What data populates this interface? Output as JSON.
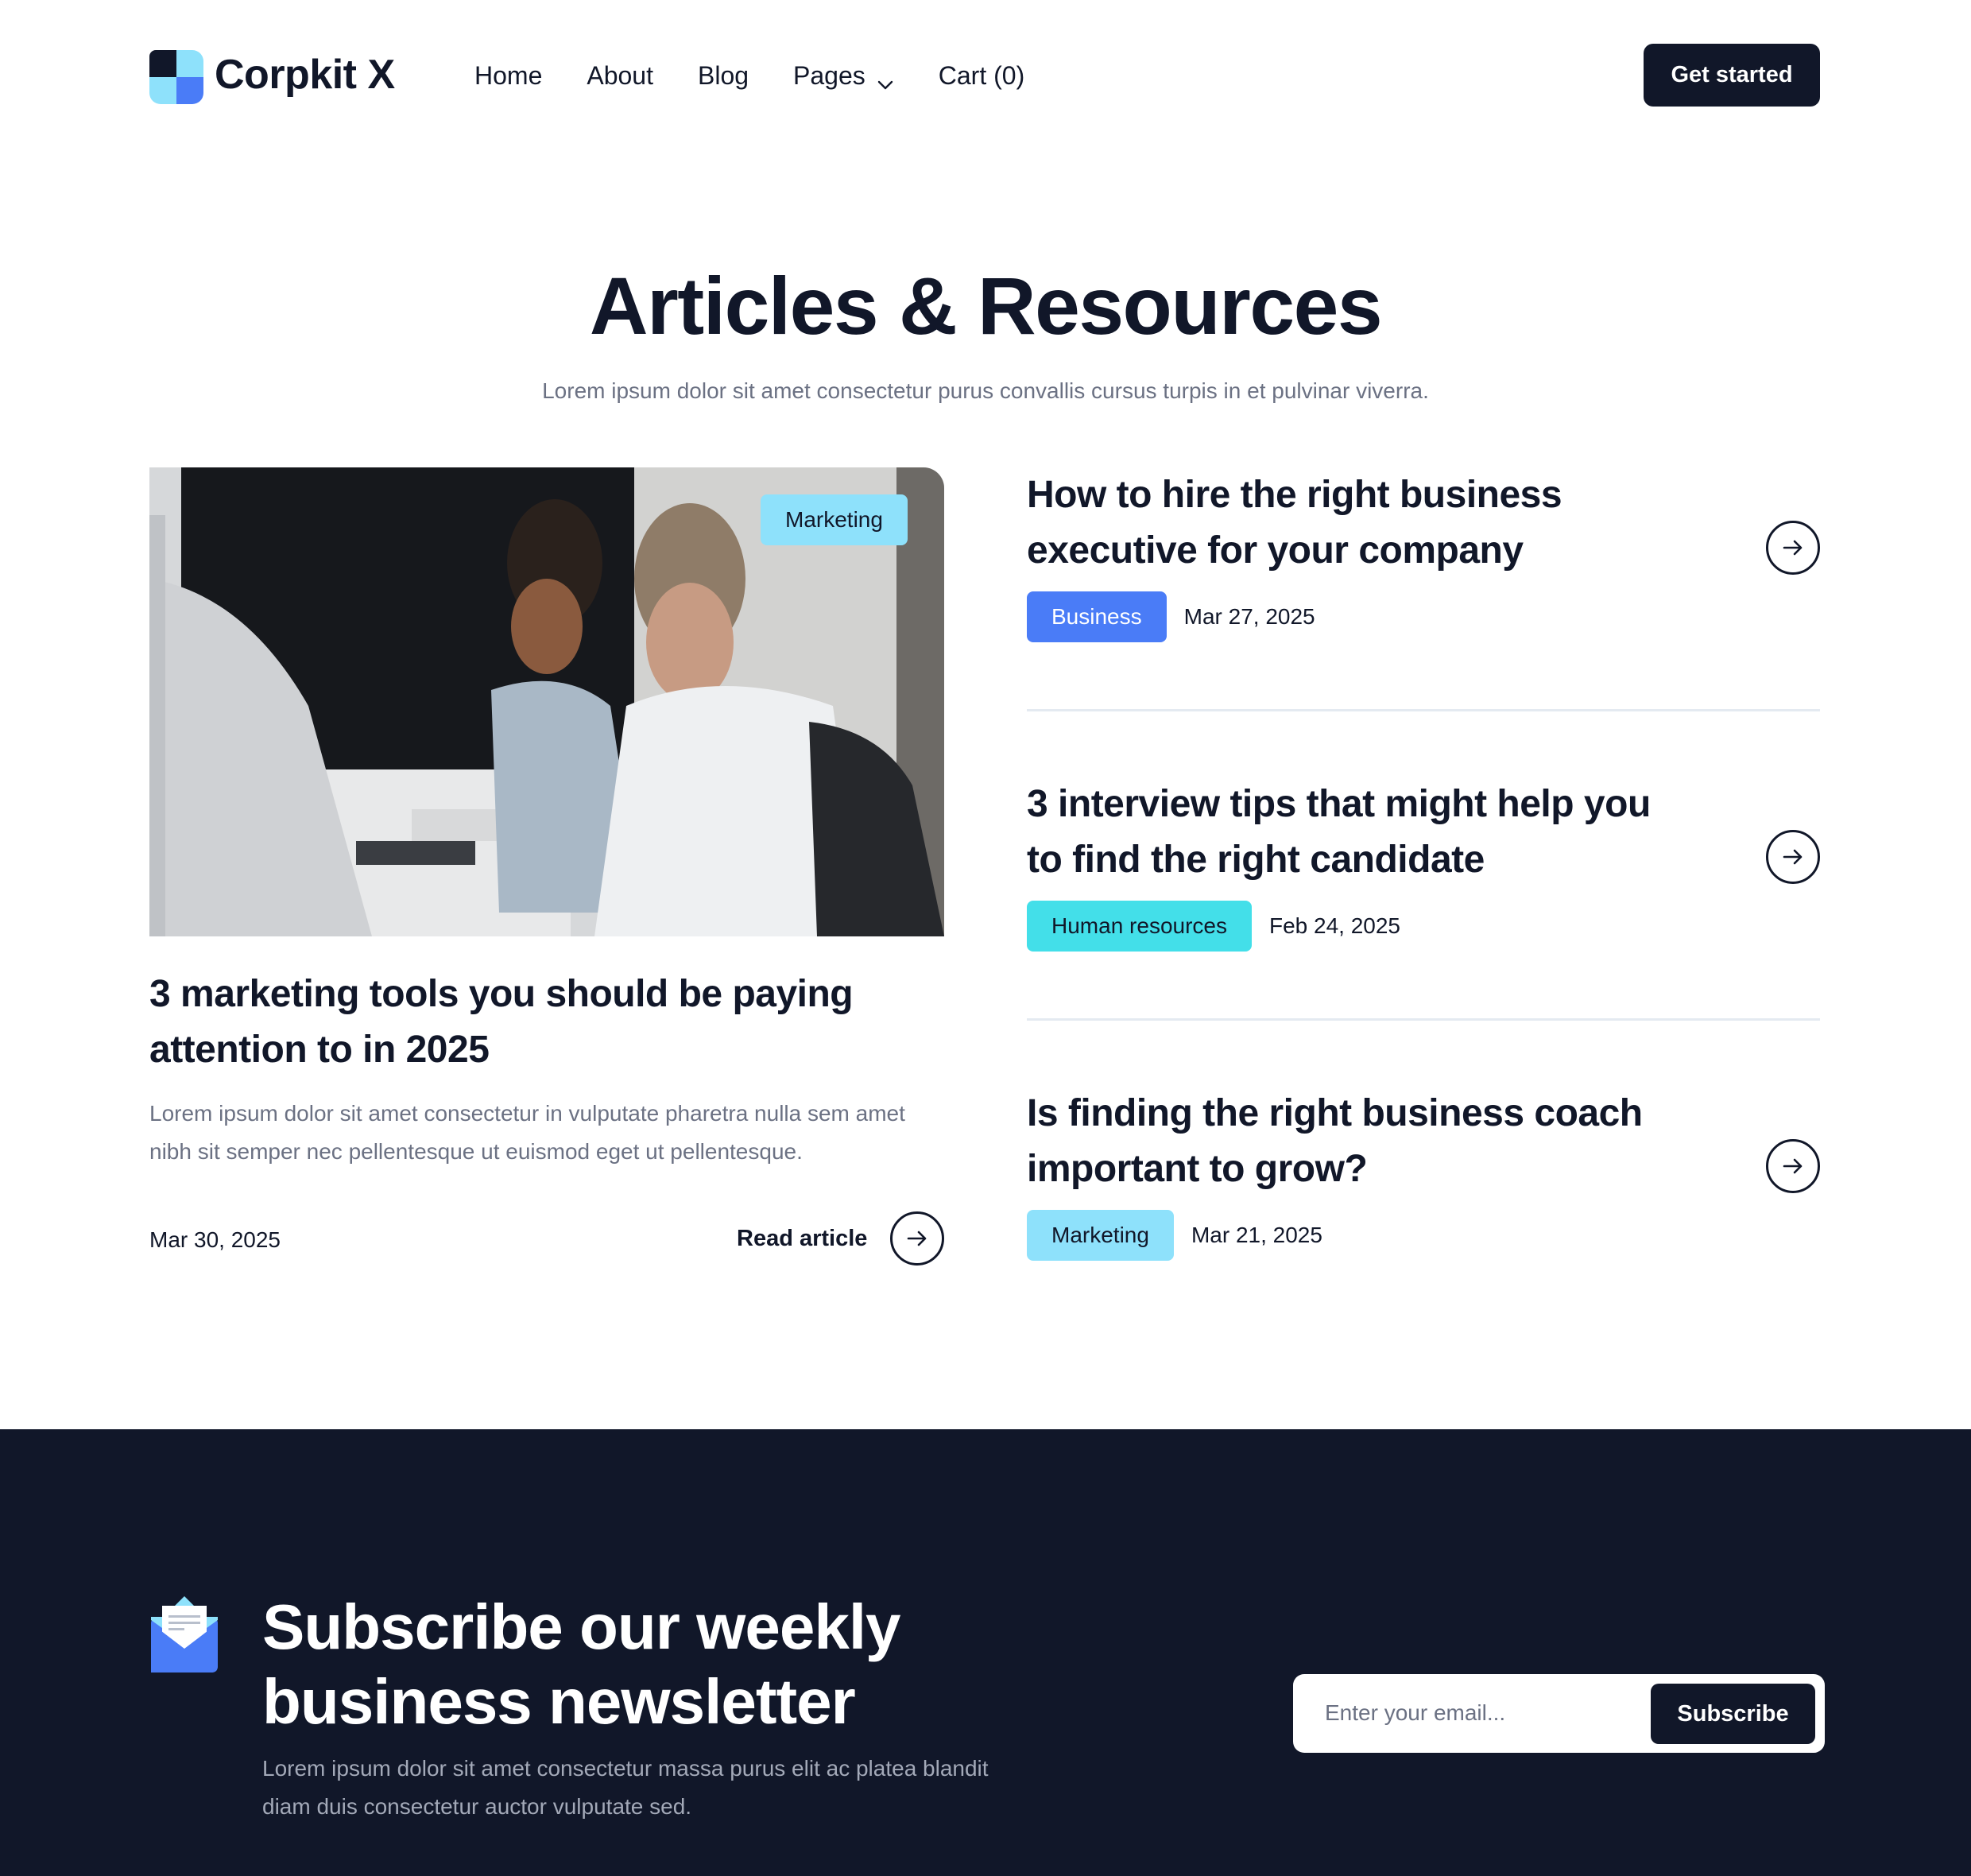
{
  "header": {
    "brand": "Corpkit X",
    "logo_icon": "four-square-logo-icon",
    "nav": [
      {
        "label": "Home"
      },
      {
        "label": "About"
      },
      {
        "label": "Blog"
      },
      {
        "label": "Pages",
        "icon": "chevron-down-icon"
      },
      {
        "label": "Cart (0)"
      }
    ],
    "cta_label": "Get started"
  },
  "hero": {
    "title": "Articles & Resources",
    "subtitle": "Lorem ipsum dolor sit amet consectetur purus convallis cursus turpis in et pulvinar viverra."
  },
  "featured": {
    "image_alt": "Three colleagues working at an office desk",
    "tag": "Marketing",
    "title": "3 marketing tools you should be paying attention to in 2025",
    "excerpt": "Lorem ipsum dolor sit amet consectetur in vulputate pharetra nulla sem amet nibh sit semper nec pellentesque ut euismod eget ut pellentesque.",
    "date": "Mar 30, 2025",
    "read_label": "Read article",
    "arrow_icon": "arrow-right-icon"
  },
  "articles": [
    {
      "title": "How to hire the right business executive for your company",
      "tag": "Business",
      "date": "Mar 27, 2025"
    },
    {
      "title": "3 interview tips that might help you to find the right candidate",
      "tag": "Human resources",
      "date": "Feb 24, 2025"
    },
    {
      "title": "Is finding the right business coach important to grow?",
      "tag": "Marketing",
      "date": "Mar 21, 2025"
    }
  ],
  "newsletter": {
    "icon": "open-envelope-icon",
    "title": "Subscribe our weekly business newsletter",
    "text": "Lorem ipsum dolor sit amet consectetur massa purus elit ac platea blandit diam duis consectetur auctor vulputate sed.",
    "email_value": "",
    "email_placeholder": "Enter your email...",
    "button_label": "Subscribe"
  },
  "colors": {
    "dark": "#111729",
    "accent_blue": "#4a7cf7",
    "accent_light_blue": "#8ee1fb",
    "accent_cyan": "#43dfe9",
    "muted_text": "#6b7183"
  }
}
